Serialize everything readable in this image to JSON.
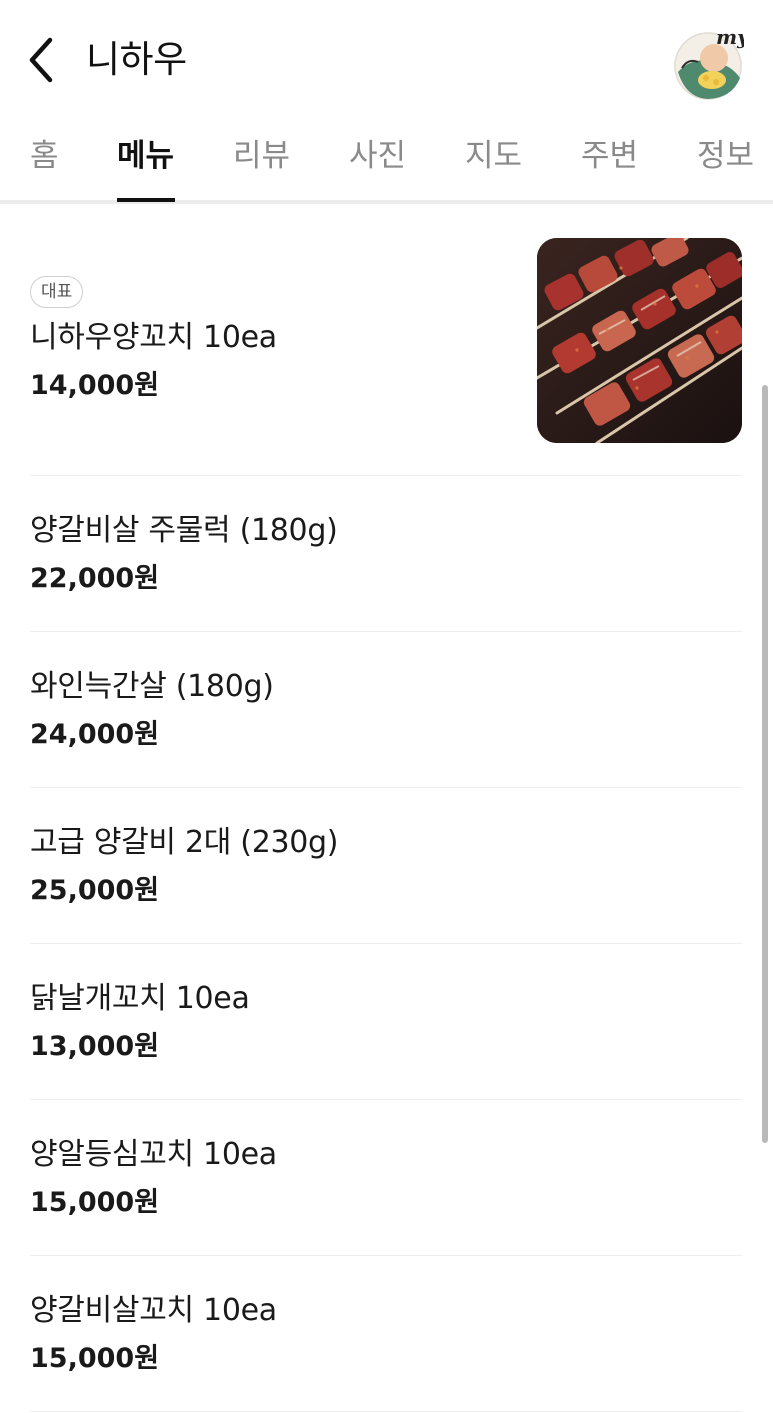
{
  "header": {
    "title": "니하우",
    "my_label": "my"
  },
  "tabs": [
    {
      "label": "홈",
      "active": false
    },
    {
      "label": "메뉴",
      "active": true
    },
    {
      "label": "리뷰",
      "active": false
    },
    {
      "label": "사진",
      "active": false
    },
    {
      "label": "지도",
      "active": false
    },
    {
      "label": "주변",
      "active": false
    },
    {
      "label": "정보",
      "active": false
    }
  ],
  "menu": {
    "items": [
      {
        "badge": "대표",
        "name": "니하우양꼬치 10ea",
        "price": "14,000원",
        "has_photo": true
      },
      {
        "name": "양갈비살 주물럭 (180g)",
        "price": "22,000원"
      },
      {
        "name": "와인늑간살 (180g)",
        "price": "24,000원"
      },
      {
        "name": "고급 양갈비 2대 (230g)",
        "price": "25,000원"
      },
      {
        "name": "닭날개꼬치 10ea",
        "price": "13,000원"
      },
      {
        "name": "양알등심꼬치 10ea",
        "price": "15,000원"
      },
      {
        "name": "양갈비살꼬치 10ea",
        "price": "15,000원"
      }
    ]
  },
  "colors": {
    "text_primary": "#111111",
    "text_muted": "#8a8a8a",
    "divider": "#eeeeee"
  }
}
